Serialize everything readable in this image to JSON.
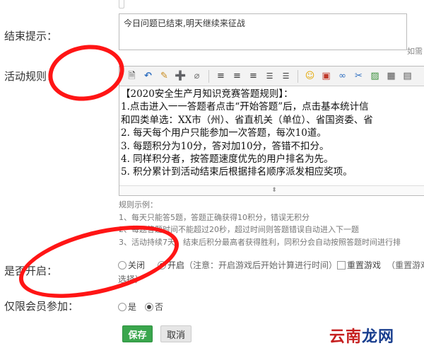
{
  "fields": {
    "end_tip": {
      "label": "结束提示：",
      "value": "今日问题已结束,明天继续来征战",
      "note": "如需"
    },
    "rules": {
      "label": "活动规则：",
      "editor_lines": [
        "【2020安全生产月知识竞赛答题规则】：",
        "1.点击进入一一答题者点击“开始答题”后，点击基本统计信",
        "和四类单选：XX市（州）、省直机关（单位）、省国资委、省",
        "2. 每天每个用户只能参加一次答题，每次10道。",
        "3. 每题积分为10分，答对加10分，答错不扣分。",
        "4. 同样积分者，按答题速度优先的用户排名为先。",
        "5. 积分累计到活动结束后根据排名顺序派发相应奖项。"
      ],
      "example_title": "规则示例：",
      "examples": [
        "1、每天只能答5题，答题正确获得10积分，错误无积分",
        "2、每题答题时间不能超过20秒，超过时间则答题错误自动进入下一题",
        "3、活动持续7天，结束后积分最高者获得胜利，同积分会自动按照答题时间进行排"
      ]
    },
    "enabled": {
      "label": "是否开启：",
      "off_label": "关闭",
      "on_label": "开启",
      "hint": "（注意：开启游戏后开始计算进行时间）",
      "reset_label": "重置游戏",
      "reset_hint": "（重置游戏",
      "reset_hint_cont": "选择）"
    },
    "members_only": {
      "label": "仅限会员参加：",
      "yes_label": "是",
      "no_label": "否"
    }
  },
  "actions": {
    "save": "保存",
    "cancel": "取消"
  },
  "watermark": {
    "part1": "云南",
    "part2": "龙网"
  },
  "colors": {
    "save_button": "#3aa64d",
    "annotation": "#ff1515"
  }
}
